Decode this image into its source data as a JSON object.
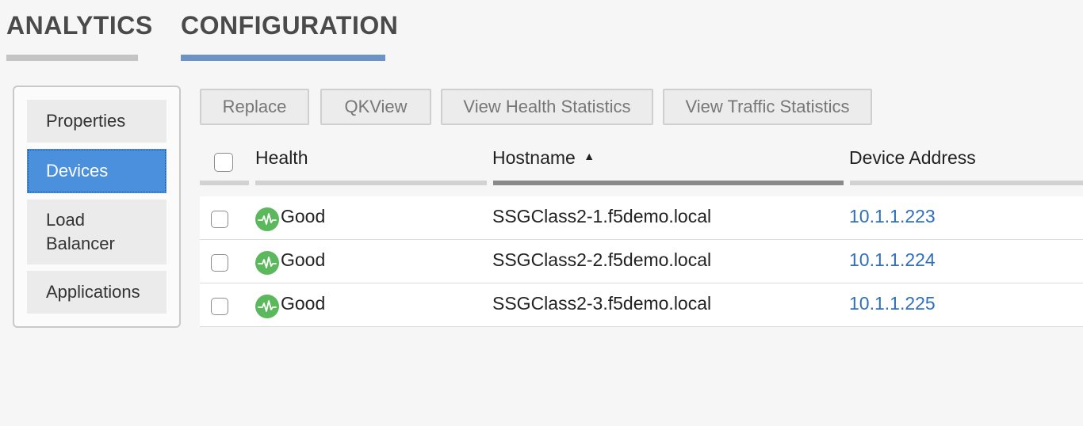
{
  "top_tabs": [
    {
      "label": "ANALYTICS"
    },
    {
      "label": "CONFIGURATION",
      "active": true
    }
  ],
  "sidebar": {
    "items": [
      {
        "label": "Properties"
      },
      {
        "label": "Devices",
        "active": true
      },
      {
        "label": "Load Balancer"
      },
      {
        "label": "Applications"
      }
    ]
  },
  "toolbar": {
    "replace_label": "Replace",
    "qkview_label": "QKView",
    "health_stats_label": "View Health Statistics",
    "traffic_stats_label": "View Traffic Statistics"
  },
  "table": {
    "columns": {
      "health": "Health",
      "hostname": "Hostname",
      "address": "Device Address"
    },
    "sort": {
      "column": "hostname",
      "direction": "ascending",
      "indicator": "▲"
    },
    "rows": [
      {
        "health": "Good",
        "health_icon": "health-good-icon",
        "hostname": "SSGClass2-1.f5demo.local",
        "address": "10.1.1.223"
      },
      {
        "health": "Good",
        "health_icon": "health-good-icon",
        "hostname": "SSGClass2-2.f5demo.local",
        "address": "10.1.1.224"
      },
      {
        "health": "Good",
        "health_icon": "health-good-icon",
        "hostname": "SSGClass2-3.f5demo.local",
        "address": "10.1.1.225"
      }
    ]
  },
  "colors": {
    "accent_blue": "#4a90dd",
    "config_tab_underline": "#6b93c6",
    "link_blue": "#2f6fbf",
    "health_good_green": "#5cb85c"
  }
}
